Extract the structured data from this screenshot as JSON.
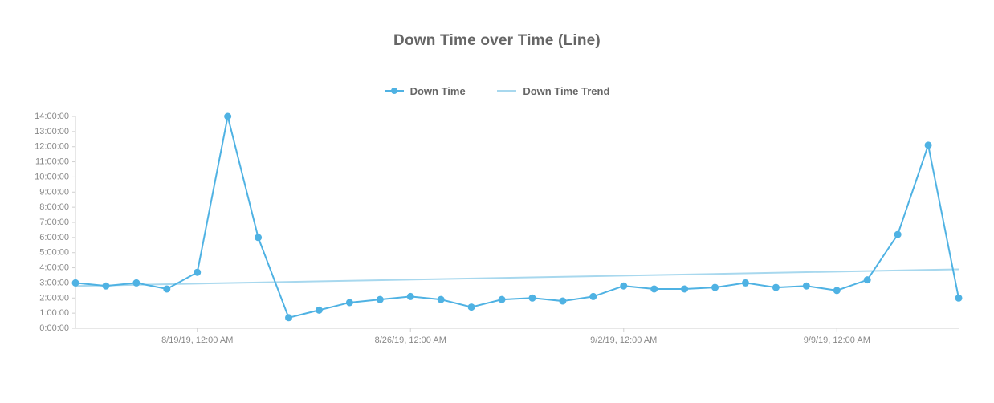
{
  "title": "Down Time over Time (Line)",
  "legend": {
    "series1": "Down Time",
    "series2": "Down Time Trend"
  },
  "colors": {
    "series_main": "#4fb2e3",
    "series_trend": "#a8d8ee",
    "axis": "#cfcfcf",
    "text": "#888888",
    "legend_text": "#666666"
  },
  "chart_data": {
    "type": "line",
    "title": "Down Time over Time (Line)",
    "xlabel": "",
    "ylabel": "",
    "ylim_hours": [
      0,
      14
    ],
    "y_tick_labels": [
      "0:00:00",
      "1:00:00",
      "2:00:00",
      "3:00:00",
      "4:00:00",
      "5:00:00",
      "6:00:00",
      "7:00:00",
      "8:00:00",
      "9:00:00",
      "10:00:00",
      "11:00:00",
      "12:00:00",
      "13:00:00",
      "14:00:00"
    ],
    "x_tick_labels": [
      "8/19/19, 12:00 AM",
      "8/26/19, 12:00 AM",
      "9/2/19, 12:00 AM",
      "9/9/19, 12:00 AM"
    ],
    "x_tick_indices": [
      4,
      11,
      18,
      25
    ],
    "series": [
      {
        "name": "Down Time",
        "type": "line_with_markers",
        "y_hours": [
          3.0,
          2.8,
          3.0,
          2.6,
          3.7,
          14.0,
          6.0,
          0.7,
          1.2,
          1.7,
          1.9,
          2.1,
          1.9,
          1.4,
          1.9,
          2.0,
          1.8,
          2.1,
          2.8,
          2.6,
          2.6,
          2.7,
          3.0,
          2.7,
          2.8,
          2.5,
          3.2,
          6.2,
          12.1,
          2.0
        ],
        "x_index": [
          0,
          1,
          2,
          3,
          4,
          5,
          6,
          7,
          8,
          9,
          10,
          11,
          12,
          13,
          14,
          15,
          16,
          17,
          18,
          19,
          20,
          21,
          22,
          23,
          24,
          25,
          26,
          27,
          28,
          29
        ]
      },
      {
        "name": "Down Time Trend",
        "type": "line_no_markers",
        "y_hours_start": 2.8,
        "y_hours_end": 3.9,
        "x_index_start": 0,
        "x_index_end": 29
      }
    ]
  }
}
